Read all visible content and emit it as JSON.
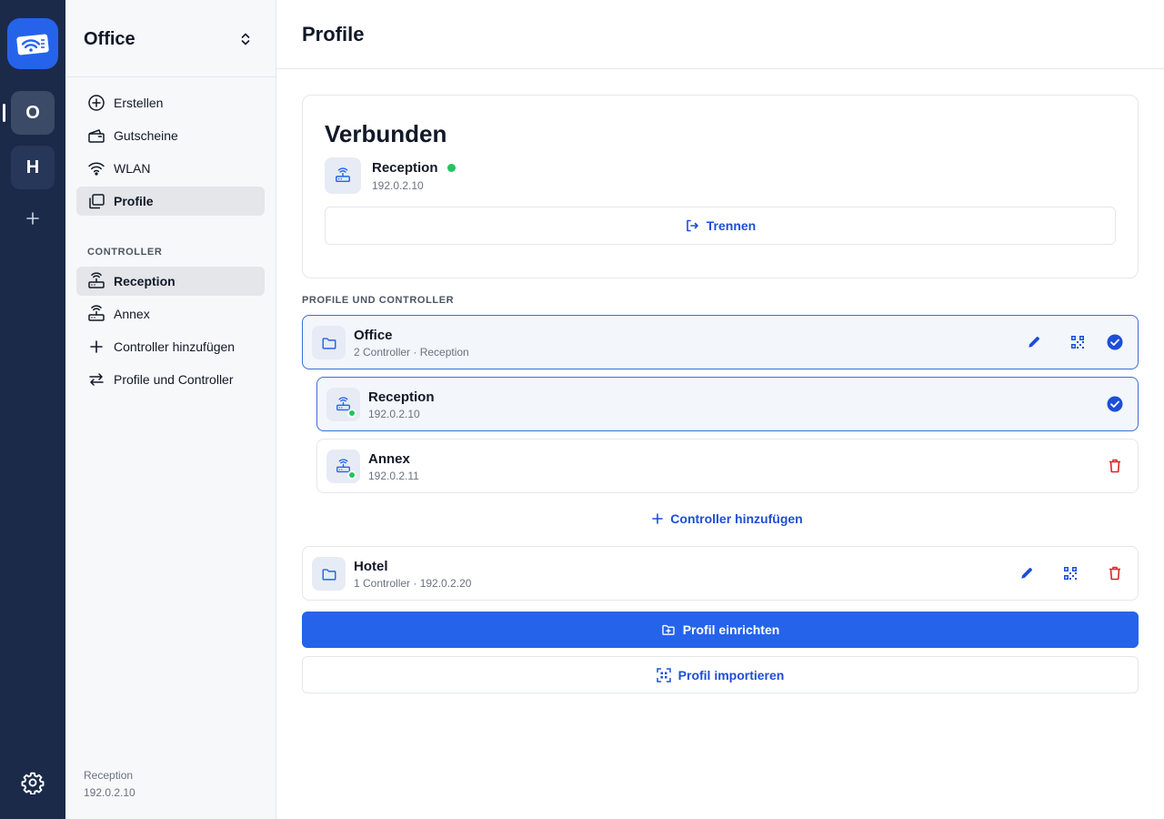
{
  "rail": {
    "logo_icon": "wifi-ticket-icon",
    "profiles": [
      {
        "initial": "O",
        "active": true
      },
      {
        "initial": "H",
        "active": false
      }
    ],
    "add_icon": "plus-icon",
    "settings_icon": "gear-icon"
  },
  "sidebar": {
    "title": "Office",
    "nav": [
      {
        "label": "Erstellen",
        "icon": "plus-circle-icon"
      },
      {
        "label": "Gutscheine",
        "icon": "ticket-icon"
      },
      {
        "label": "WLAN",
        "icon": "wifi-icon"
      },
      {
        "label": "Profile",
        "icon": "profiles-icon",
        "active": true
      }
    ],
    "section_label": "CONTROLLER",
    "controllers": [
      {
        "label": "Reception",
        "icon": "router-icon",
        "active": true
      },
      {
        "label": "Annex",
        "icon": "router-icon"
      },
      {
        "label": "Controller hinzufügen",
        "icon": "plus-icon"
      },
      {
        "label": "Profile und Controller",
        "icon": "swap-arrows-icon"
      }
    ],
    "footer": {
      "name": "Reception",
      "ip": "192.0.2.10"
    }
  },
  "main": {
    "title": "Profile",
    "connected": {
      "title": "Verbunden",
      "device_name": "Reception",
      "device_ip": "192.0.2.10",
      "disconnect_label": "Trennen"
    },
    "section_label": "PROFILE UND CONTROLLER",
    "profiles": [
      {
        "name": "Office",
        "sub": "2 Controller · Reception",
        "selected": true,
        "controllers": [
          {
            "name": "Reception",
            "ip": "192.0.2.10",
            "selected": true
          },
          {
            "name": "Annex",
            "ip": "192.0.2.11",
            "selected": false
          }
        ],
        "add_controller_label": "Controller hinzufügen"
      },
      {
        "name": "Hotel",
        "sub": "1 Controller · 192.0.2.20",
        "selected": false
      }
    ],
    "setup_label": "Profil einrichten",
    "import_label": "Profil importieren"
  },
  "colors": {
    "rail_bg": "#1c2a4a",
    "accent": "#2563eb",
    "link": "#1d4ed8",
    "danger": "#dc2626",
    "online": "#22c55e",
    "selected_border": "#3b6fd4"
  }
}
